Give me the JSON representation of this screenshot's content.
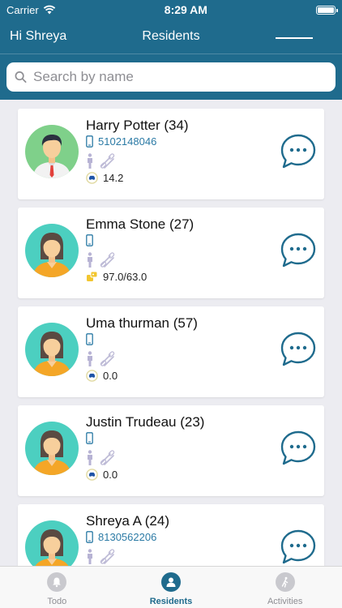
{
  "status_bar": {
    "carrier": "Carrier",
    "time": "8:29 AM"
  },
  "navbar": {
    "greeting": "Hi Shreya",
    "title": "Residents"
  },
  "search": {
    "placeholder": "Search by name"
  },
  "residents": [
    {
      "name": "Harry Potter (34)",
      "phone": "5102148046",
      "value": "14.2",
      "value_icon": "stomach-icon",
      "avatar": "male-avatar-icon",
      "avatar_bg": "#7fd08a"
    },
    {
      "name": "Emma Stone (27)",
      "phone": "",
      "value": "97.0/63.0",
      "value_icon": "blood-pressure-icon",
      "avatar": "female-avatar-icon",
      "avatar_bg": "#4ccfc0"
    },
    {
      "name": "Uma thurman (57)",
      "phone": "",
      "value": "0.0",
      "value_icon": "stomach-icon",
      "avatar": "female-avatar-icon",
      "avatar_bg": "#4ccfc0"
    },
    {
      "name": "Justin Trudeau (23)",
      "phone": "",
      "value": "0.0",
      "value_icon": "stomach-icon",
      "avatar": "female-avatar-icon",
      "avatar_bg": "#4ccfc0"
    },
    {
      "name": "Shreya A (24)",
      "phone": "8130562206",
      "value": "",
      "value_icon": "",
      "avatar": "female-avatar-icon",
      "avatar_bg": "#4ccfc0"
    }
  ],
  "tabs": [
    {
      "label": "Todo",
      "icon": "bell-icon",
      "active": false
    },
    {
      "label": "Residents",
      "icon": "person-icon",
      "active": true
    },
    {
      "label": "Activities",
      "icon": "walking-icon",
      "active": false
    }
  ],
  "colors": {
    "brand": "#1f6b8d",
    "chat": "#1f6b8d",
    "link": "#2b7aa5"
  }
}
